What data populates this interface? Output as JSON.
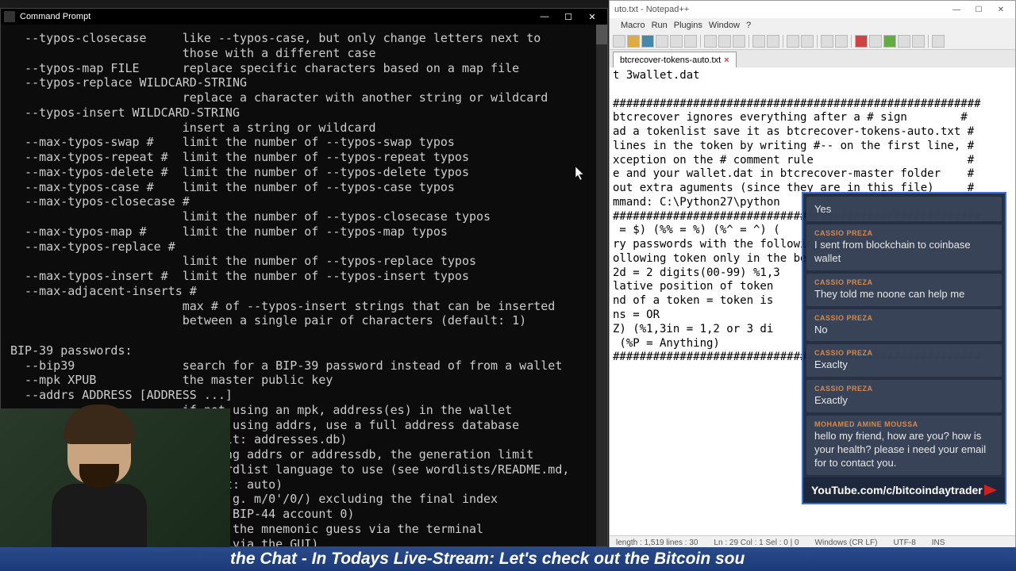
{
  "cmd": {
    "title": "Command Prompt",
    "content": "  --typos-closecase     like --typos-case, but only change letters next to\n                        those with a different case\n  --typos-map FILE      replace specific characters based on a map file\n  --typos-replace WILDCARD-STRING\n                        replace a character with another string or wildcard\n  --typos-insert WILDCARD-STRING\n                        insert a string or wildcard\n  --max-typos-swap #    limit the number of --typos-swap typos\n  --max-typos-repeat #  limit the number of --typos-repeat typos\n  --max-typos-delete #  limit the number of --typos-delete typos\n  --max-typos-case #    limit the number of --typos-case typos\n  --max-typos-closecase #\n                        limit the number of --typos-closecase typos\n  --max-typos-map #     limit the number of --typos-map typos\n  --max-typos-replace #\n                        limit the number of --typos-replace typos\n  --max-typos-insert #  limit the number of --typos-insert typos\n  --max-adjacent-inserts #\n                        max # of --typos-insert strings that can be inserted\n                        between a single pair of characters (default: 1)\n\nBIP-39 passwords:\n  --bip39               search for a BIP-39 password instead of from a wallet\n  --mpk XPUB            the master public key\n  --addrs ADDRESS [ADDRESS ...]\n                        if not using an mpk, address(es) in the wallet\n  --address   [FILE]    if not using addrs, use a full address database\n                        (default: addresses.db)\n  --addr        UNT     if using addrs or addressdb, the generation limit\n  --lang        -CODE   the wordlist language to use (see wordlists/README.md,\n                        default: auto)\n  --bip3                ath (e.g. m/0'/0/) excluding the final index\n                        fault: BIP-44 account 0)\n                        pt for the mnemonic guess via the terminal\n                        fault: via the GUI)"
  },
  "npp": {
    "title": "uto.txt - Notepad++",
    "menu": [
      "",
      "Macro",
      "Run",
      "Plugins",
      "Window",
      "?"
    ],
    "tab": "btcrecover-tokens-auto.txt",
    "content": "t 3wallet.dat\n\n#######################################################\nbtcrecover ignores everything after a # sign        #\nad a tokenlist save it as btcrecover-tokens-auto.txt #\nlines in the token by writing #-- on the first line, #\nxception on the # comment rule                       #\ne and your wallet.dat in btcrecover-master folder    #\nout extra aguments (since they are in this file)     #\nmmand: C:\\Python27\\python\n#######################################################\n = $) (%% = %) (%^ = ^) (\nry passwords with the following\nollowing token only in the be\n2d = 2 digits(00-99) %1,3\nlative position of token\nnd of a token = token is\nns = OR\nZ) (%1,3in = 1,2 or 3 di\n (%P = Anything)\n#######################################################",
    "status": {
      "length": "length : 1,519   lines : 30",
      "pos": "Ln : 29   Col : 1   Sel : 0 | 0",
      "encoding": "Windows (CR LF)",
      "charset": "UTF-8",
      "mode": "INS"
    }
  },
  "chat": {
    "messages": [
      {
        "author": "",
        "text": "Yes"
      },
      {
        "author": "CASSIO PREZA",
        "text": "I sent from blockchain to coinbase wallet"
      },
      {
        "author": "CASSIO PREZA",
        "text": "They told me noone can help me"
      },
      {
        "author": "CASSIO PREZA",
        "text": "No"
      },
      {
        "author": "CASSIO PREZA",
        "text": "Exaclty"
      },
      {
        "author": "CASSIO PREZA",
        "text": "Exactly"
      },
      {
        "author": "MOHAMED AMINE MOUSSA",
        "text": "hello my friend, how are you? how is your health? please i need your email for to contact you."
      }
    ],
    "footer": "YouTube.com/c/bitcoindaytrader"
  },
  "ticker": "the Chat - In Todays Live-Stream: Let's check out the Bitcoin sou"
}
